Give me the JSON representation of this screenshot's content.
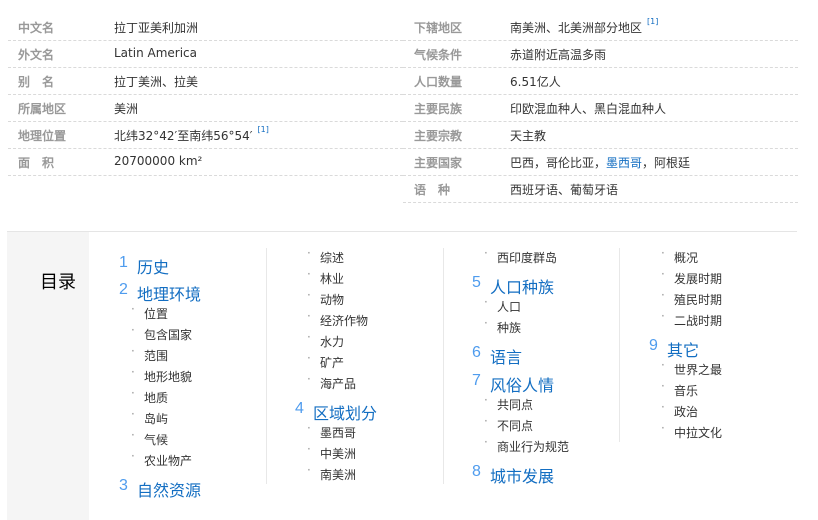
{
  "basic_info": {
    "left": [
      {
        "key": "中文名",
        "value": "拉丁亚美利加洲"
      },
      {
        "key": "外文名",
        "value": "Latin America"
      },
      {
        "key": "别　名",
        "value": "拉丁美洲、拉美"
      },
      {
        "key": "所属地区",
        "value": "美洲"
      },
      {
        "key": "地理位置",
        "value": "北纬32°42′至南纬56°54′",
        "sup": "[1]"
      },
      {
        "key": "面　积",
        "value": "20700000 km²"
      }
    ],
    "right": [
      {
        "key": "下辖地区",
        "value": "南美洲、北美洲部分地区",
        "sup": "[1]"
      },
      {
        "key": "气候条件",
        "value": "赤道附近高温多雨"
      },
      {
        "key": "人口数量",
        "value": "6.51亿人"
      },
      {
        "key": "主要民族",
        "value": "印欧混血种人、黑白混血种人"
      },
      {
        "key": "主要宗教",
        "value": "天主教"
      },
      {
        "key": "主要国家",
        "value_parts": [
          "巴西，哥伦比亚，",
          "墨西哥",
          "，阿根廷"
        ]
      },
      {
        "key": "语　种",
        "value": "西班牙语、葡萄牙语"
      }
    ]
  },
  "toc": {
    "title": "目录",
    "col1": {
      "h1": {
        "num": "1",
        "text": "历史"
      },
      "h2": {
        "num": "2",
        "text": "地理环境"
      },
      "h2_items": [
        "位置",
        "包含国家",
        "范围",
        "地形地貌",
        "地质",
        "岛屿",
        "气候",
        "农业物产"
      ],
      "h3": {
        "num": "3",
        "text": "自然资源"
      }
    },
    "col2": {
      "items_a": [
        "综述",
        "林业",
        "动物",
        "经济作物",
        "水力",
        "矿产",
        "海产品"
      ],
      "h4": {
        "num": "4",
        "text": "区域划分"
      },
      "items_b": [
        "墨西哥",
        "中美洲",
        "南美洲"
      ]
    },
    "col3": {
      "item_a": "西印度群岛",
      "h5": {
        "num": "5",
        "text": "人口种族"
      },
      "items_5": [
        "人口",
        "种族"
      ],
      "h6": {
        "num": "6",
        "text": "语言"
      },
      "h7": {
        "num": "7",
        "text": "风俗人情"
      },
      "items_7": [
        "共同点",
        "不同点",
        "商业行为规范"
      ],
      "h8": {
        "num": "8",
        "text": "城市发展"
      }
    },
    "col4": {
      "items_a": [
        "概况",
        "发展时期",
        "殖民时期",
        "二战时期"
      ],
      "h9": {
        "num": "9",
        "text": "其它"
      },
      "items_9": [
        "世界之最",
        "音乐",
        "政治",
        "中拉文化"
      ]
    }
  }
}
